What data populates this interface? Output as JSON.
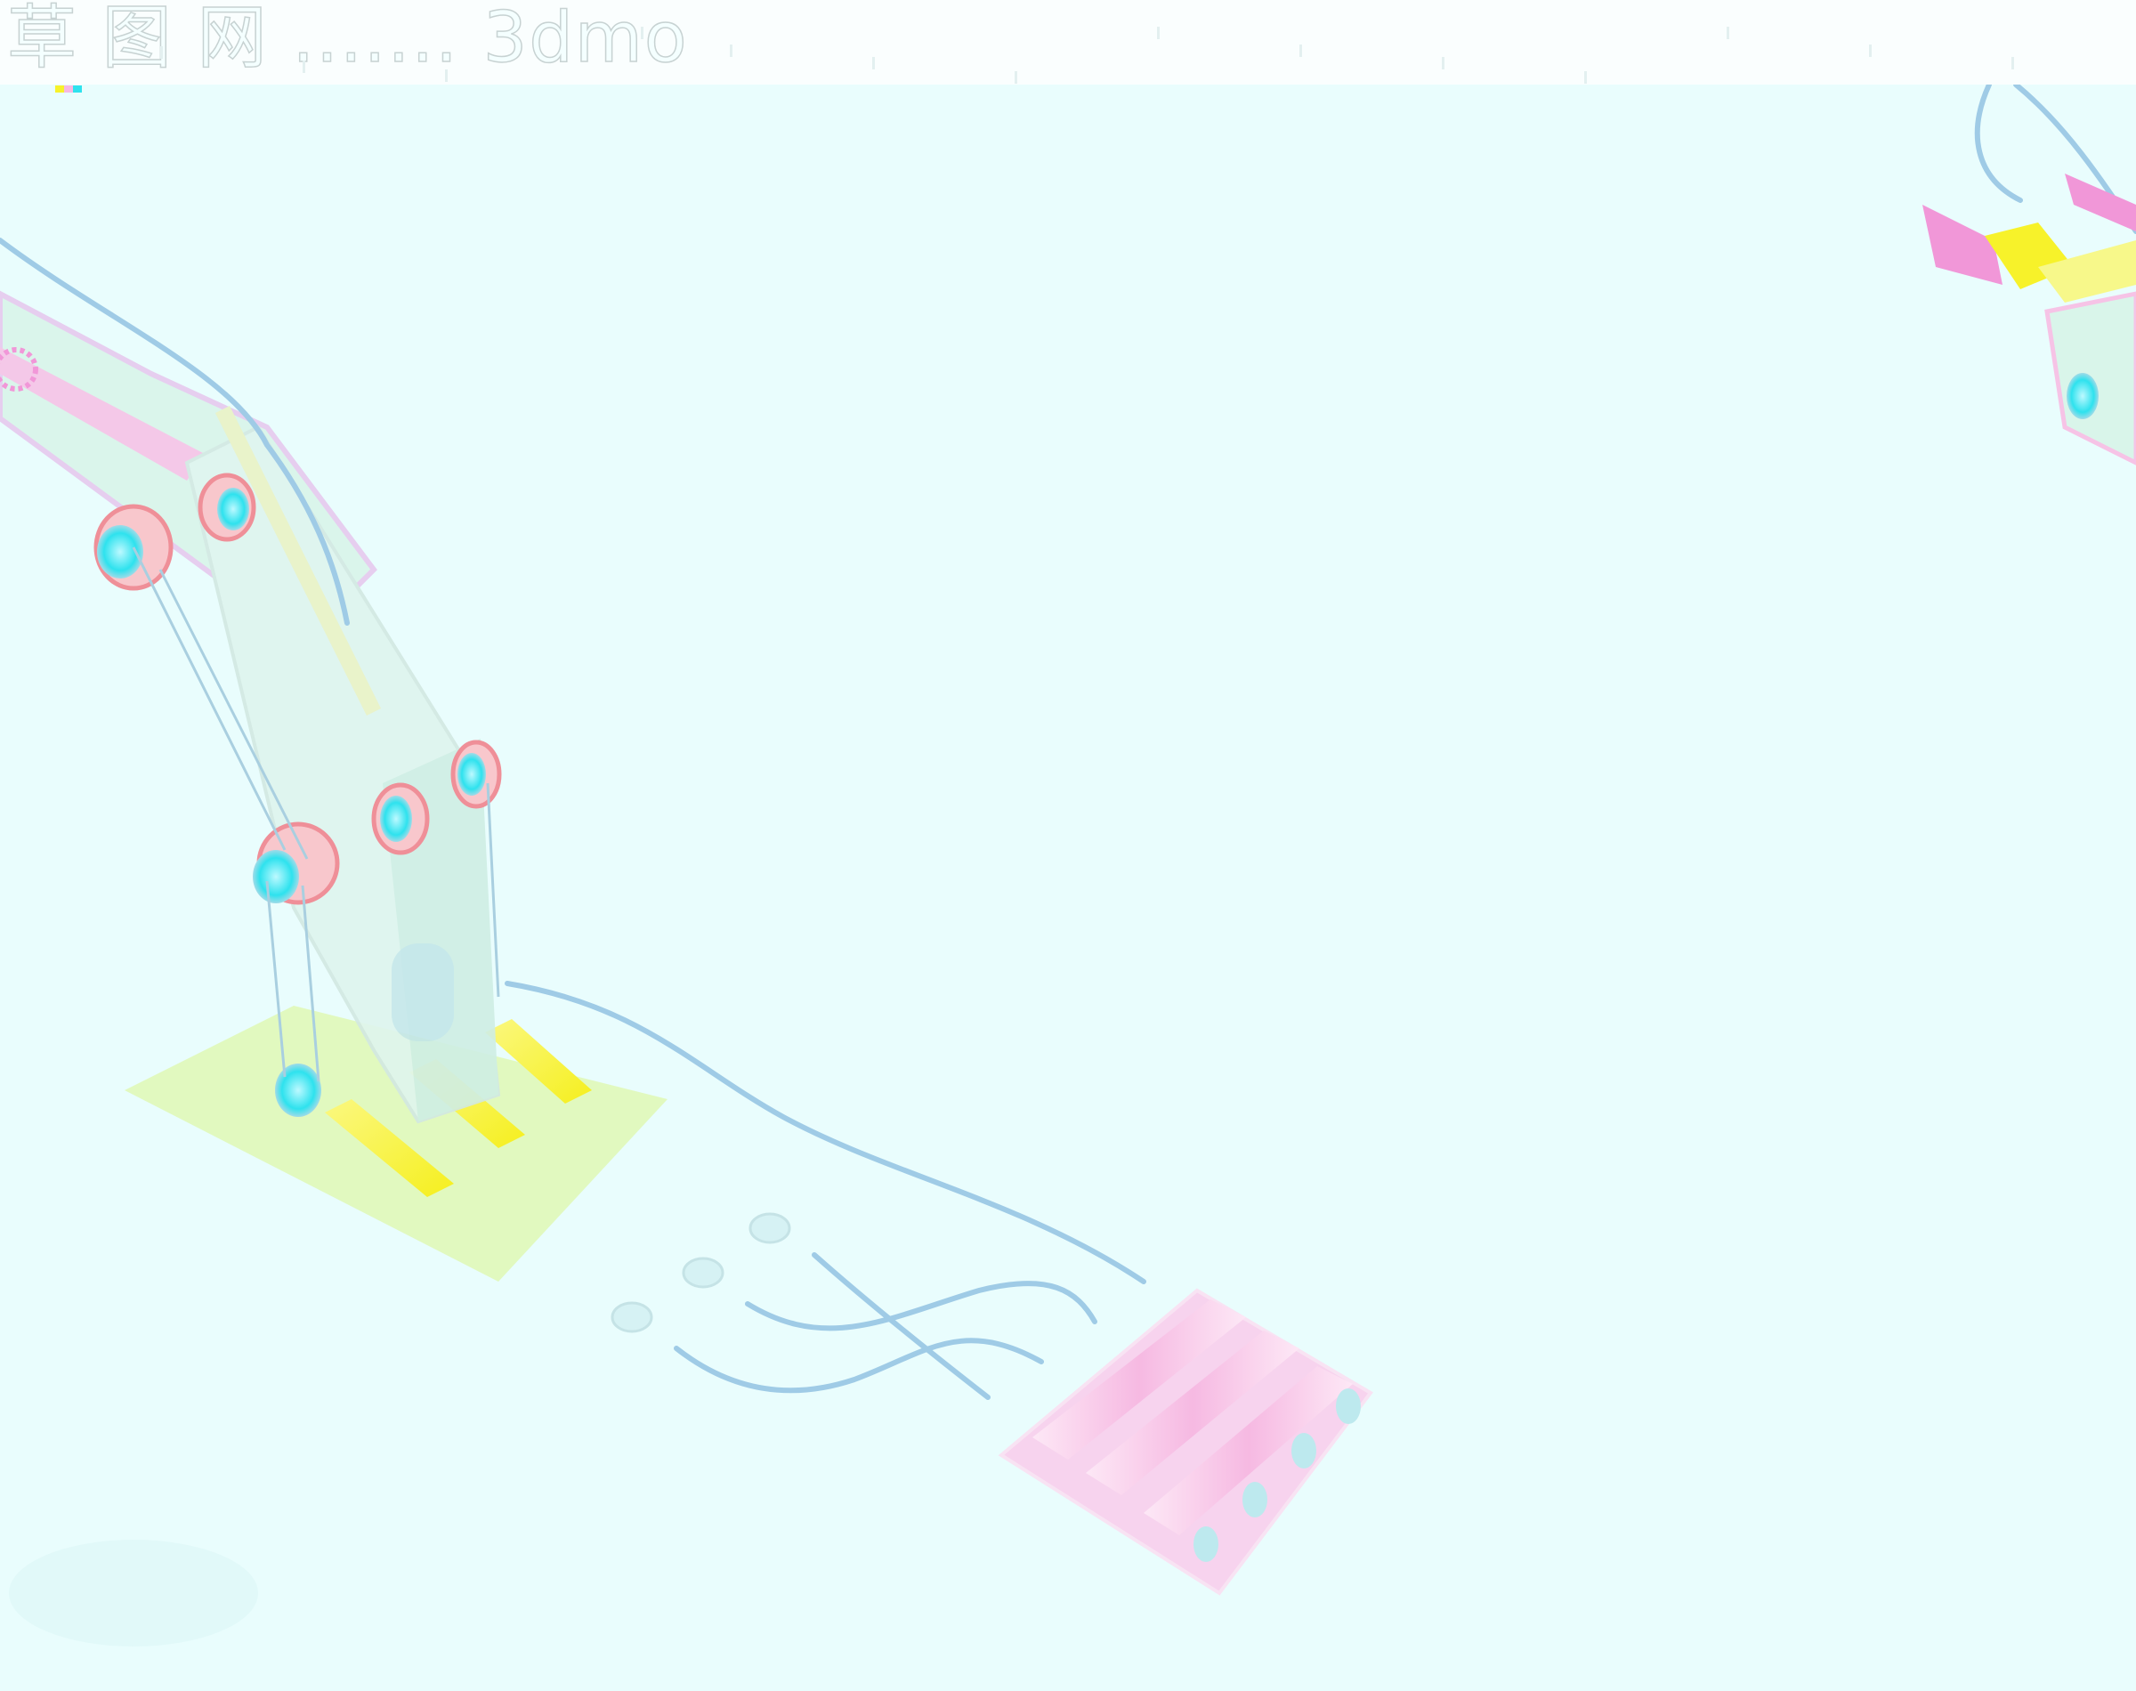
{
  "watermark": {
    "text": "草 图 网 ....... 3dmo"
  },
  "colors": {
    "background": "#e9fdfd",
    "cable": "#9fcbe6",
    "pulley_cyan": "#2ee2ee",
    "pulley_ring": "#ef8f98",
    "rail_yellow": "#f7f22a",
    "base_green": "#dff8b4",
    "plate_pink": "#f6b9e2",
    "frame_mint": "#d9f5ea"
  },
  "icons": [
    "cable-robot-model",
    "pulley-icon",
    "rail-icon"
  ]
}
